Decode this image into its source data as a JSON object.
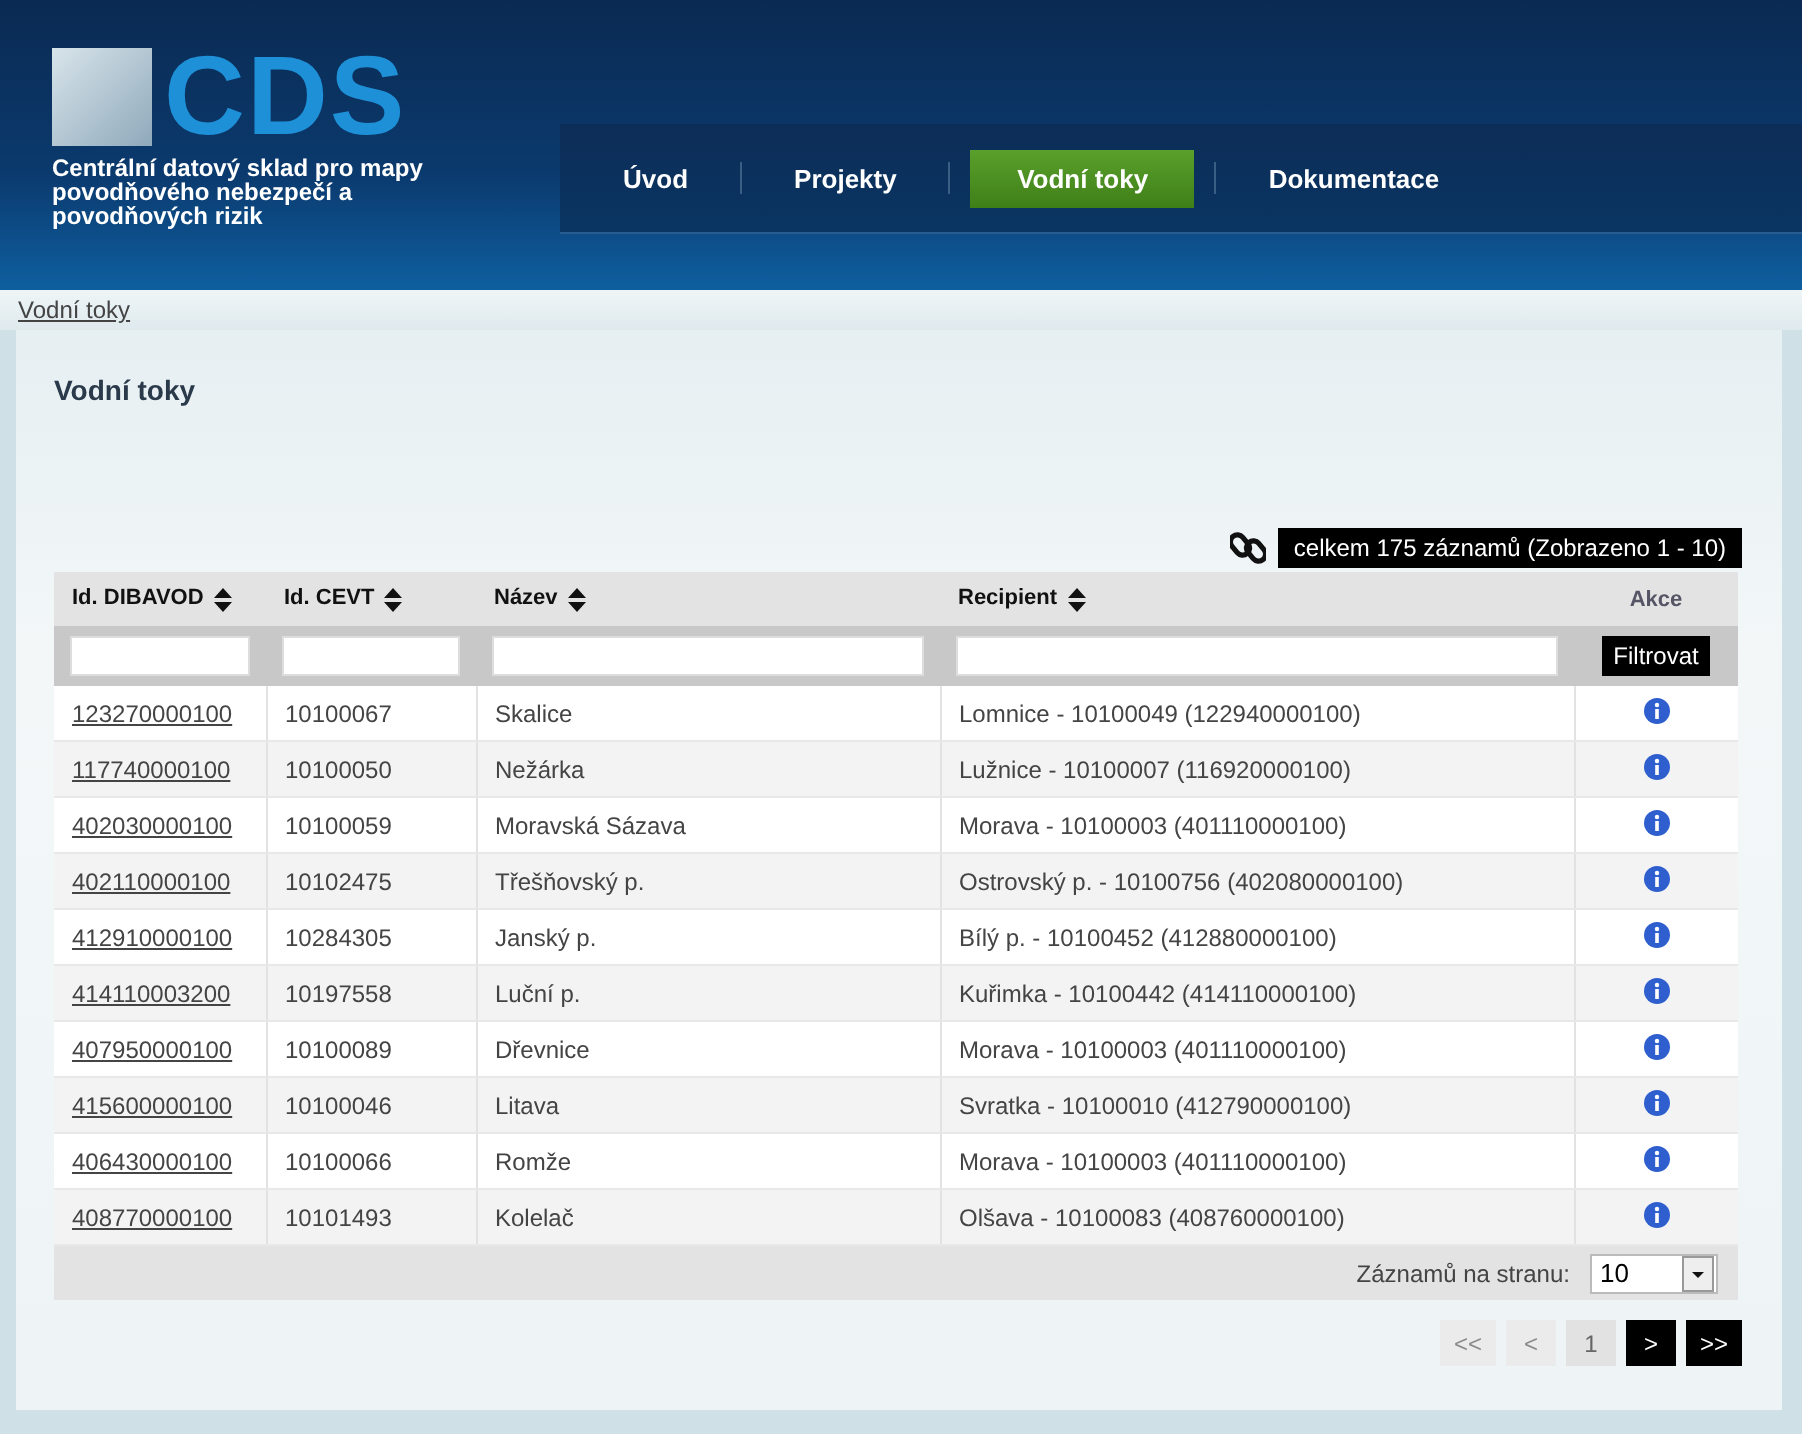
{
  "header": {
    "logo_text": "CDS",
    "subtitle": "Centrální datový sklad pro mapy povodňového nebezpečí a povodňových rizik"
  },
  "nav": [
    {
      "label": "Úvod",
      "selected": false
    },
    {
      "label": "Projekty",
      "selected": false
    },
    {
      "label": "Vodní toky",
      "selected": true
    },
    {
      "label": "Dokumentace",
      "selected": false
    }
  ],
  "breadcrumb": "Vodní toky",
  "page_title": "Vodní toky",
  "record_count": "celkem 175 záznamů (Zobrazeno 1 - 10)",
  "table": {
    "columns": [
      {
        "label": "Id. DIBAVOD",
        "sortable": true
      },
      {
        "label": "Id. CEVT",
        "sortable": true
      },
      {
        "label": "Název",
        "sortable": true
      },
      {
        "label": "Recipient",
        "sortable": true
      },
      {
        "label": "Akce",
        "sortable": false
      }
    ],
    "filter_button": "Filtrovat",
    "rows": [
      {
        "id": "123270000100",
        "cevt": "10100067",
        "name": "Skalice",
        "recipient": "Lomnice - 10100049 (122940000100)"
      },
      {
        "id": "117740000100",
        "cevt": "10100050",
        "name": "Nežárka",
        "recipient": "Lužnice - 10100007 (116920000100)"
      },
      {
        "id": "402030000100",
        "cevt": "10100059",
        "name": "Moravská Sázava",
        "recipient": "Morava - 10100003 (401110000100)"
      },
      {
        "id": "402110000100",
        "cevt": "10102475",
        "name": "Třešňovský p.",
        "recipient": "Ostrovský p. - 10100756 (402080000100)"
      },
      {
        "id": "412910000100",
        "cevt": "10284305",
        "name": "Janský p.",
        "recipient": "Bílý p. - 10100452 (412880000100)"
      },
      {
        "id": "414110003200",
        "cevt": "10197558",
        "name": "Luční p.",
        "recipient": "Kuřimka - 10100442 (414110000100)"
      },
      {
        "id": "407950000100",
        "cevt": "10100089",
        "name": "Dřevnice",
        "recipient": "Morava - 10100003 (401110000100)"
      },
      {
        "id": "415600000100",
        "cevt": "10100046",
        "name": "Litava",
        "recipient": "Svratka - 10100010 (412790000100)"
      },
      {
        "id": "406430000100",
        "cevt": "10100066",
        "name": "Romže",
        "recipient": "Morava - 10100003 (401110000100)"
      },
      {
        "id": "408770000100",
        "cevt": "10101493",
        "name": "Kolelač",
        "recipient": "Olšava - 10100083 (408760000100)"
      }
    ]
  },
  "per_page": {
    "label": "Záznamů na stranu:",
    "value": "10"
  },
  "pager": [
    {
      "label": "<<",
      "disabled": true,
      "selected": false
    },
    {
      "label": "<",
      "disabled": true,
      "selected": false
    },
    {
      "label": "1",
      "disabled": false,
      "selected": true
    },
    {
      "label": ">",
      "disabled": false,
      "selected": false
    },
    {
      "label": ">>",
      "disabled": false,
      "selected": false
    }
  ]
}
